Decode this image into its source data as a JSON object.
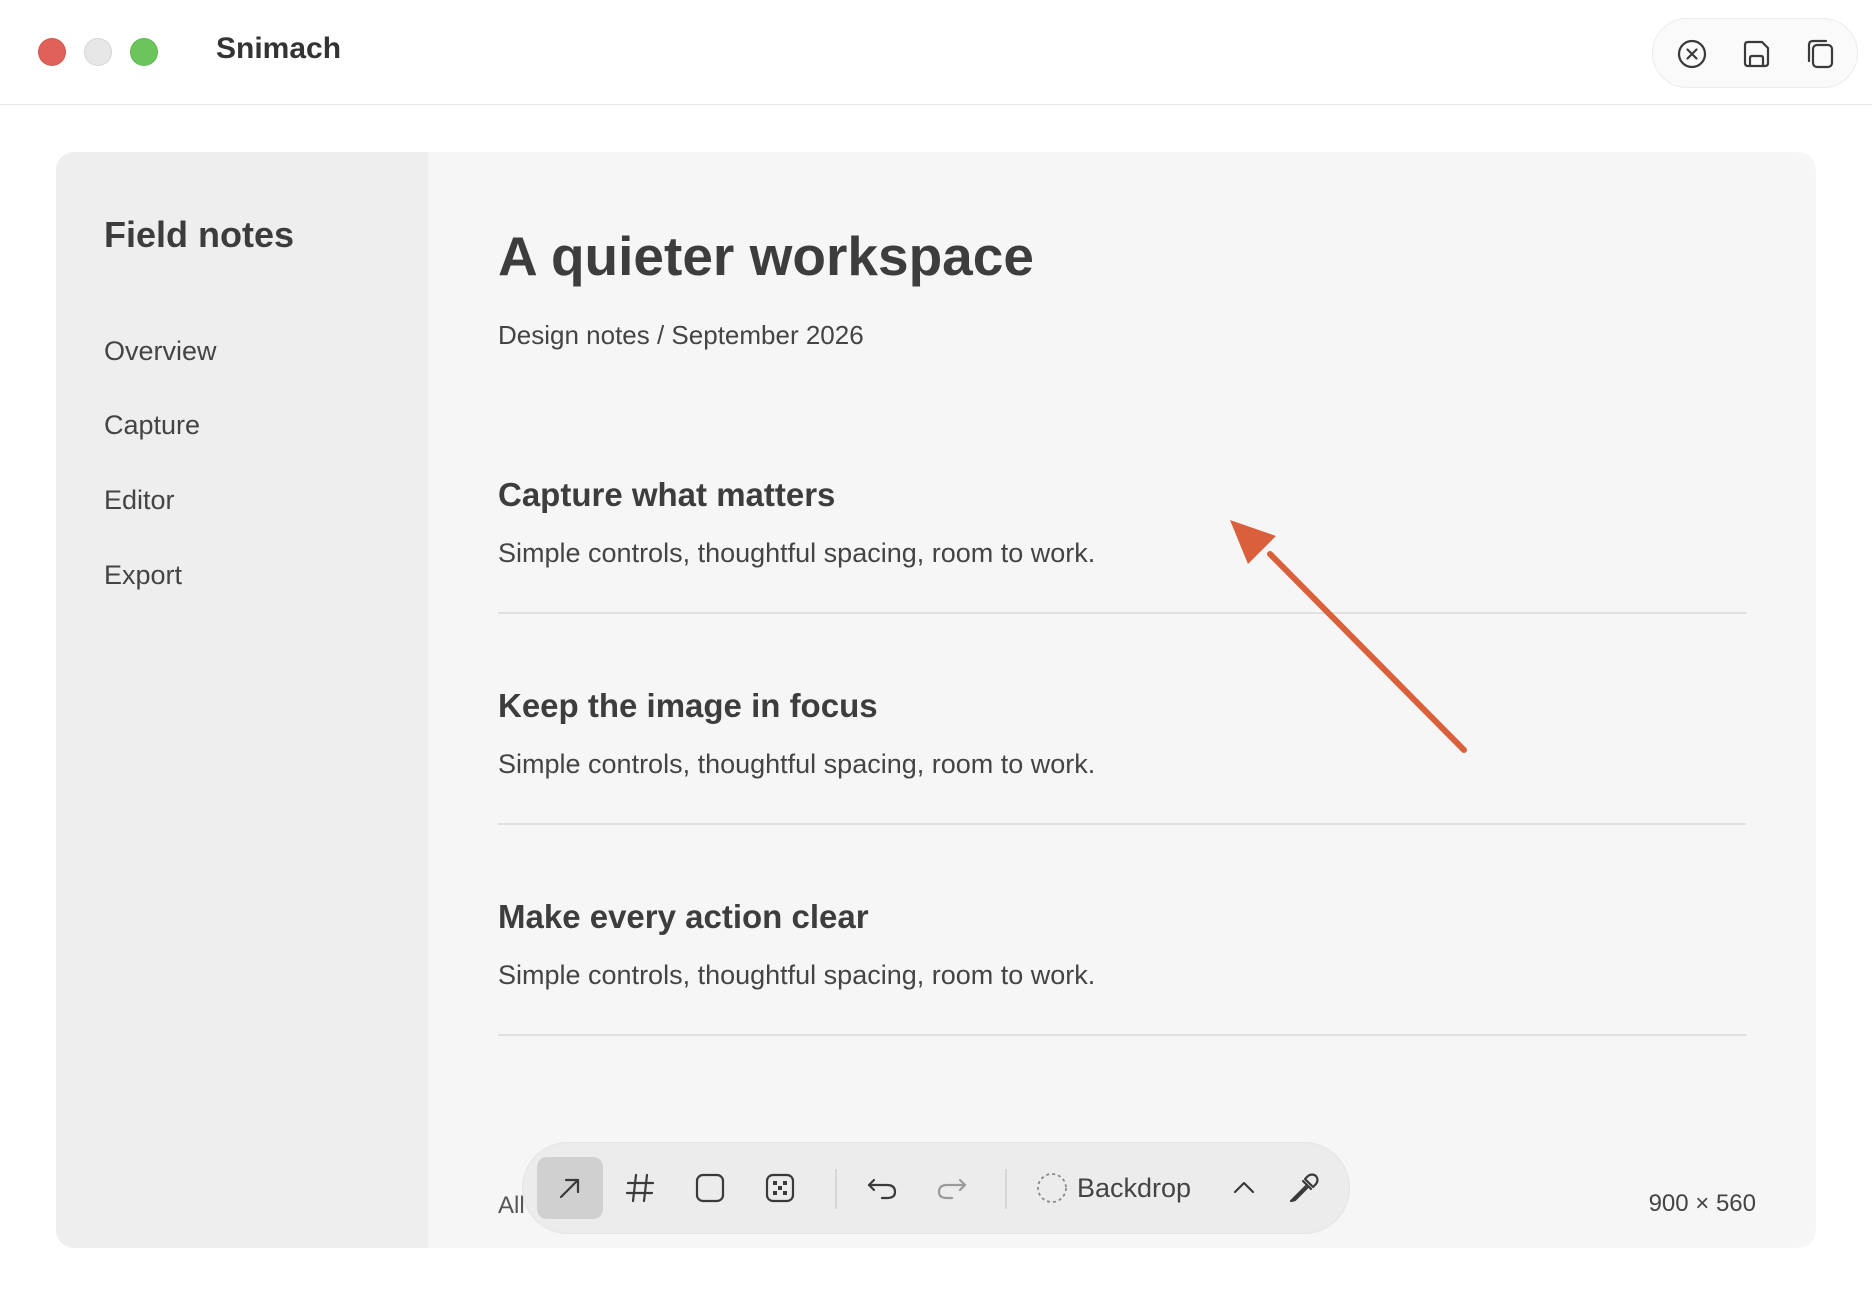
{
  "window": {
    "title": "Snimach",
    "actions": [
      {
        "name": "close-circle-icon"
      },
      {
        "name": "save-icon"
      },
      {
        "name": "copy-icon"
      }
    ]
  },
  "sidebar": {
    "title": "Field notes",
    "items": [
      {
        "label": "Overview"
      },
      {
        "label": "Capture"
      },
      {
        "label": "Editor"
      },
      {
        "label": "Export"
      }
    ]
  },
  "main": {
    "title": "A quieter workspace",
    "subtitle": "Design notes / September 2026",
    "sections": [
      {
        "heading": "Capture what matters",
        "body": "Simple controls, thoughtful spacing, room to work."
      },
      {
        "heading": "Keep the image in focus",
        "body": "Simple controls, thoughtful spacing, room to work."
      },
      {
        "heading": "Make every action clear",
        "body": "Simple controls, thoughtful spacing, room to work."
      }
    ]
  },
  "annotation": {
    "type": "arrow",
    "color": "#d9603a"
  },
  "footer": {
    "all_label": "All",
    "size": "900 × 560"
  },
  "toolbar": {
    "tools": [
      {
        "name": "arrow-tool-icon",
        "active": true
      },
      {
        "name": "hash-tool-icon",
        "active": false
      },
      {
        "name": "rectangle-tool-icon",
        "active": false
      },
      {
        "name": "pixelate-tool-icon",
        "active": false
      },
      {
        "name": "undo-icon",
        "active": false
      },
      {
        "name": "redo-icon",
        "active": false
      }
    ],
    "backdrop_label": "Backdrop",
    "accent": "#d9603a"
  }
}
